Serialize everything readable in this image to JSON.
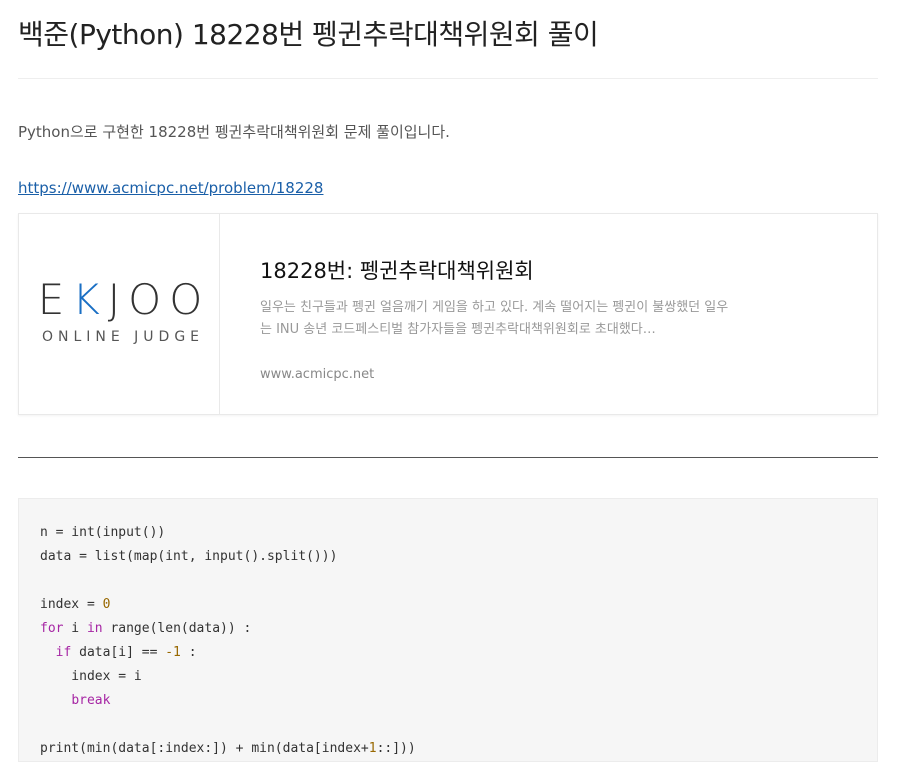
{
  "post": {
    "title": "백준(Python) 18228번 펭귄추락대책위원회 풀이",
    "intro": "Python으로 구현한 18228번 펭귄추락대책위원회 문제 풀이입니다.",
    "link": "https://www.acmicpc.net/problem/18228"
  },
  "card": {
    "logo_main_prefix": "E",
    "logo_main_k": "K",
    "logo_main_suffix": "JOO",
    "logo_sub": "ONLINE JUDGE",
    "title": "18228번: 펭귄추락대책위원회",
    "description": "일우는 친구들과 펭귄 얼음깨기 게임을 하고 있다. 계속 떨어지는 펭귄이 불쌍했던 일우는 INU 송년 코드페스티벌 참가자들을 펭귄추락대책위원회로 초대했다…",
    "host": "www.acmicpc.net"
  },
  "code": {
    "language": "python",
    "lines": [
      "n = int(input())",
      "data = list(map(int, input().split()))",
      "",
      "index = 0",
      "for i in range(len(data)) :",
      "  if data[i] == -1 :",
      "    index = i",
      "    break",
      "",
      "print(min(data[:index:]) + min(data[index+1::]))"
    ]
  },
  "colors": {
    "link": "#1a5fa8",
    "logo_accent": "#1a6fc4",
    "keyword": "#a626a4",
    "number": "#986801",
    "code_bg": "#f6f6f6"
  }
}
